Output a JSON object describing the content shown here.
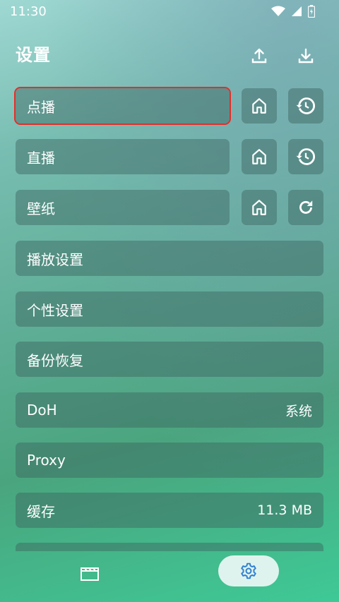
{
  "status_bar": {
    "time": "11:30"
  },
  "header": {
    "title": "设置",
    "upload_icon": "upload-icon",
    "download_icon": "download-icon"
  },
  "rows": {
    "vod": {
      "label": "点播"
    },
    "live": {
      "label": "直播"
    },
    "wallpaper": {
      "label": "壁纸"
    },
    "playback": {
      "label": "播放设置"
    },
    "personal": {
      "label": "个性设置"
    },
    "backup": {
      "label": "备份恢复"
    },
    "doh": {
      "label": "DoH",
      "value": "系统"
    },
    "proxy": {
      "label": "Proxy"
    },
    "cache": {
      "label": "缓存",
      "value": "11.3 MB"
    }
  },
  "icons": {
    "home": "home-icon",
    "history": "history-icon",
    "refresh": "refresh-icon",
    "film": "film-icon",
    "settings": "gear-icon"
  },
  "colors": {
    "focus_outline": "#e0302b",
    "nav_active_bg": "#dff3ee",
    "nav_active_icon": "#2f7fd0"
  }
}
